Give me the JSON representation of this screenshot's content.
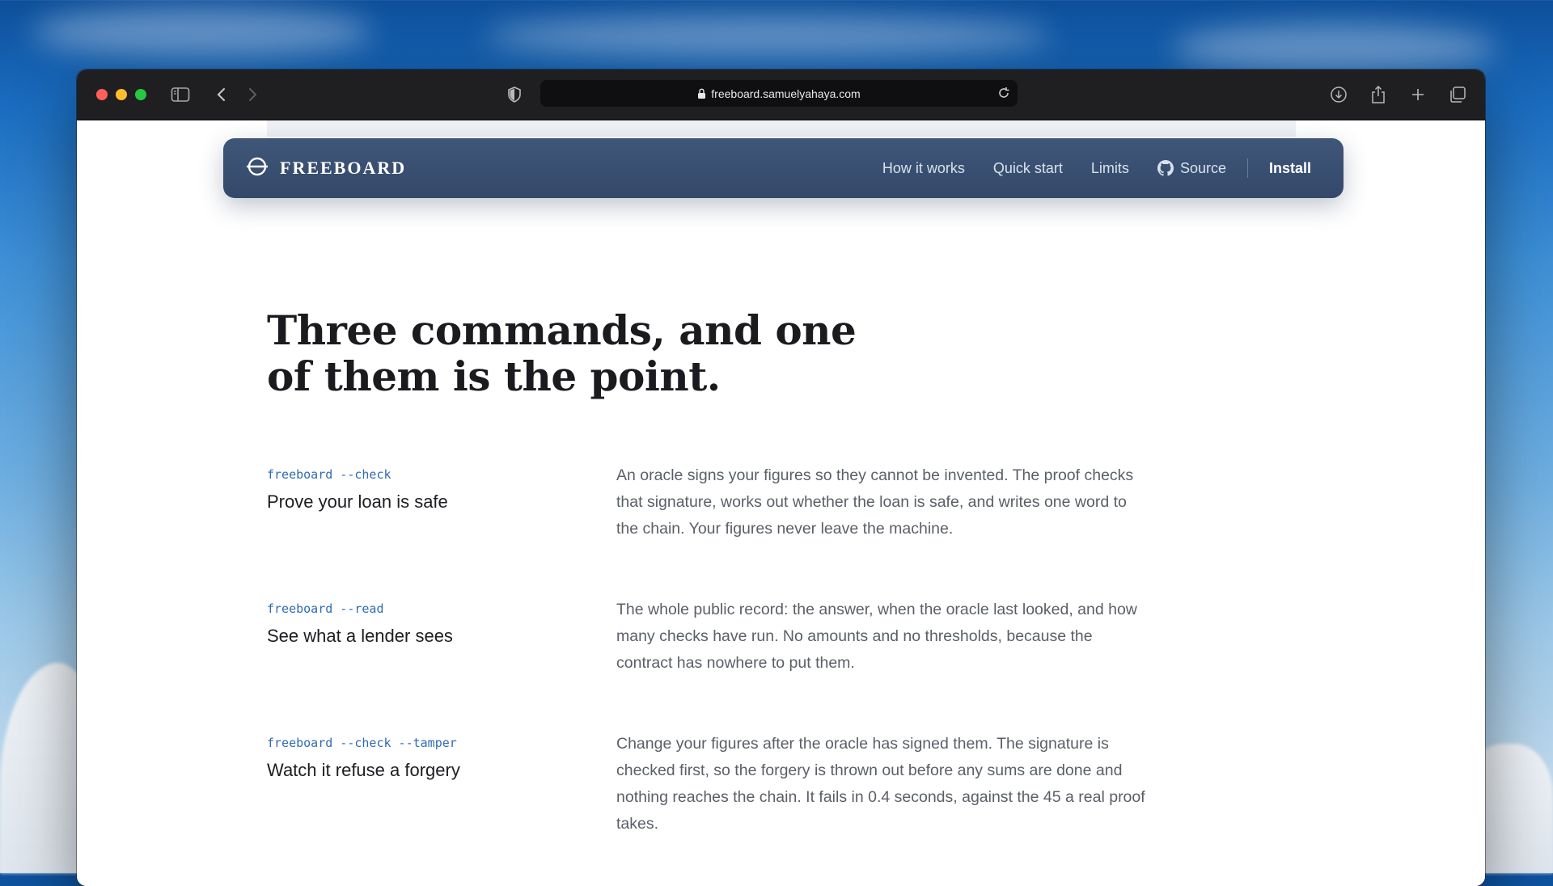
{
  "browser": {
    "url": "freeboard.samuelyahaya.com",
    "icons": [
      "sidebar-icon",
      "back-icon",
      "forward-icon",
      "shield-icon",
      "lock-icon",
      "reload-icon",
      "download-icon",
      "share-icon",
      "new-tab-icon",
      "tabs-overview-icon"
    ]
  },
  "nav": {
    "brand": "FREEBOARD",
    "links": [
      "How it works",
      "Quick start",
      "Limits"
    ],
    "source": "Source",
    "install": "Install"
  },
  "hero": {
    "line1": "Three commands, and one",
    "line2": "of them is the point."
  },
  "commands": [
    {
      "cmd": "freeboard --check",
      "title": "Prove your loan is safe",
      "desc": "An oracle signs your figures so they cannot be invented. The proof checks that signature, works out whether the loan is safe, and writes one word to the chain. Your figures never leave the machine."
    },
    {
      "cmd": "freeboard --read",
      "title": "See what a lender sees",
      "desc": "The whole public record: the answer, when the oracle last looked, and how many checks have run. No amounts and no thresholds, because the contract has nowhere to put them."
    },
    {
      "cmd": "freeboard --check --tamper",
      "title": "Watch it refuse a forgery",
      "desc": "Change your figures after the oracle has signed them. The signature is checked first, so the forgery is thrown out before any sums are done and nothing reaches the chain. It fails in 0.4 seconds, against the 45 a real proof takes."
    }
  ],
  "colors": {
    "navbar": "#3a5072",
    "command": "#2f6bb3",
    "heading": "#1b1b1f",
    "body_text": "#5a5f67"
  }
}
